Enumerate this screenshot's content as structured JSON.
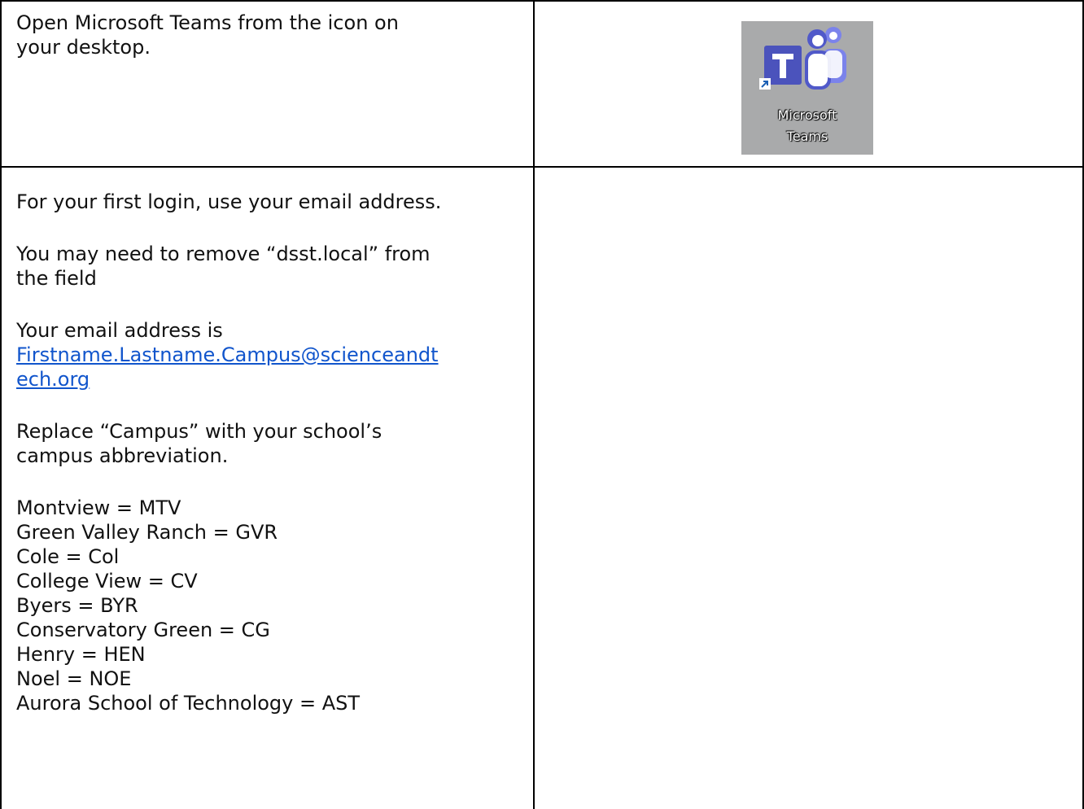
{
  "row1": {
    "instruction": [
      "Open Microsoft Teams from the icon on",
      "your desktop."
    ],
    "icon": {
      "name": "microsoft-teams-icon",
      "letter": "T",
      "label_line1": "Microsoft",
      "label_line2": "Teams",
      "background": "#a9aaab",
      "brand_color": "#5059c9"
    }
  },
  "row2": {
    "line1": "For your first login, use your email address.",
    "line2a": "You may need to remove “dsst.local” from",
    "line2b": "the field",
    "line3": "Your email address is",
    "email_part1": "Firstname.Lastname.Campus@scienceandt",
    "email_part2": "ech.org",
    "line4a": "Replace “Campus” with your school’s",
    "line4b": "campus abbreviation.",
    "campuses": [
      "Montview = MTV",
      "Green Valley Ranch = GVR",
      "Cole = Col",
      "College View = CV",
      "Byers = BYR",
      "Conservatory Green = CG",
      "Henry = HEN",
      "Noel = NOE",
      "Aurora School of Technology = AST"
    ]
  }
}
